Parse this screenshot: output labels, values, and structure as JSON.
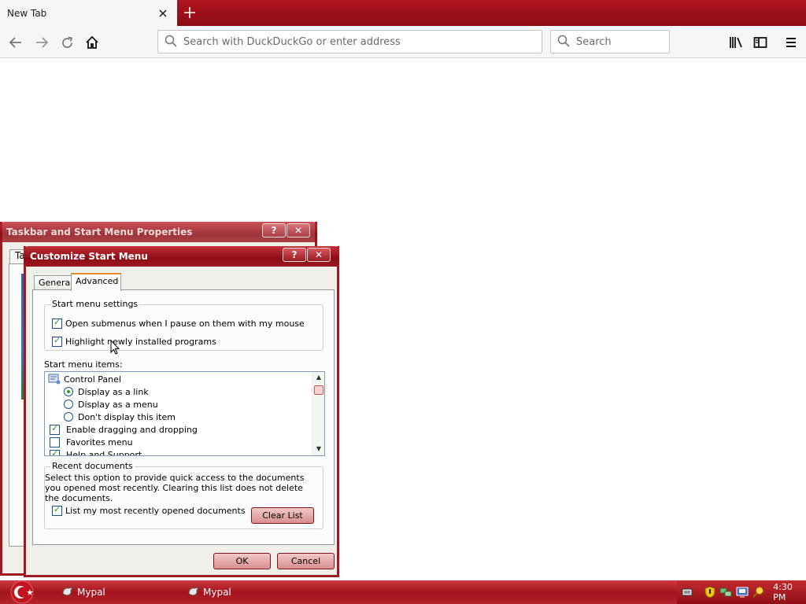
{
  "browser": {
    "tab": {
      "title": "New Tab",
      "close_icon": "close-icon"
    },
    "new_tab_icon": "plus-icon",
    "nav": {
      "back_icon": "back-arrow-icon",
      "forward_icon": "forward-arrow-icon",
      "reload_icon": "reload-icon",
      "home_icon": "home-icon"
    },
    "urlbar": {
      "placeholder": "Search with DuckDuckGo or enter address",
      "value": ""
    },
    "searchbar": {
      "placeholder": "Search",
      "value": ""
    },
    "toolbar_icons": [
      "library-icon",
      "sidebar-icon",
      "menu-icon"
    ],
    "accent_color": "#9d1820"
  },
  "back_dialog": {
    "title": "Taskbar and Start Menu Properties",
    "help_label": "?",
    "close_label": "✕",
    "tab_label": "Ta"
  },
  "dialog": {
    "title": "Customize Start Menu",
    "help_label": "?",
    "close_label": "✕",
    "tabs": [
      {
        "label": "General",
        "active": false
      },
      {
        "label": "Advanced",
        "active": true
      }
    ],
    "settings_group": {
      "label": "Start menu settings",
      "options": [
        {
          "label": "Open submenus when I pause on them with my mouse",
          "checked": true
        },
        {
          "label": "Highlight newly installed programs",
          "checked": true
        }
      ]
    },
    "items_label": "Start menu items:",
    "items": [
      {
        "label": "Control Panel",
        "kind": "header"
      },
      {
        "label": "Display as a link",
        "kind": "radio",
        "checked": true
      },
      {
        "label": "Display as a menu",
        "kind": "radio",
        "checked": false
      },
      {
        "label": "Don't display this item",
        "kind": "radio",
        "checked": false
      },
      {
        "label": "Enable dragging and dropping",
        "kind": "check",
        "checked": true
      },
      {
        "label": "Favorites menu",
        "kind": "check",
        "checked": false
      },
      {
        "label": "Help and Support",
        "kind": "check",
        "checked": true
      }
    ],
    "recent_group": {
      "label": "Recent documents",
      "description": "Select this option to provide quick access to the documents you opened most recently.  Clearing this list does not delete the documents.",
      "list_option": {
        "label": "List my most recently opened documents",
        "checked": true
      },
      "clear_button": "Clear List"
    },
    "ok_button": "OK",
    "cancel_button": "Cancel"
  },
  "taskbar": {
    "items": [
      {
        "label": "Mypal"
      },
      {
        "label": "Mypal"
      }
    ],
    "clock": "4:30 PM",
    "tray_icons": [
      "keyboard-icon",
      "shield-icon",
      "network-icon",
      "monitor-icon",
      "search-icon"
    ]
  }
}
